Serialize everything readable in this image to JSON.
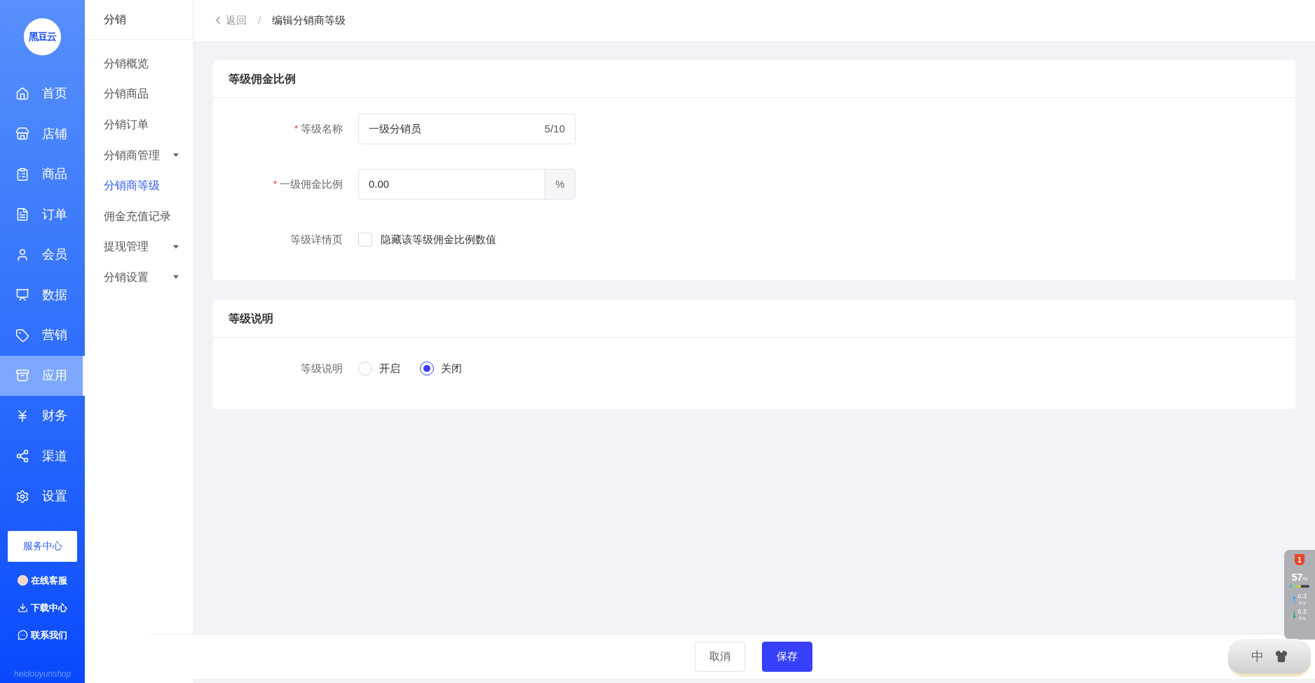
{
  "logo": {
    "text": "黑豆云"
  },
  "nav": [
    {
      "label": "首页",
      "selected": false
    },
    {
      "label": "店铺",
      "selected": false
    },
    {
      "label": "商品",
      "selected": false
    },
    {
      "label": "订单",
      "selected": false
    },
    {
      "label": "会员",
      "selected": false
    },
    {
      "label": "数据",
      "selected": false
    },
    {
      "label": "营销",
      "selected": false
    },
    {
      "label": "应用",
      "selected": true
    },
    {
      "label": "财务",
      "selected": false
    },
    {
      "label": "渠道",
      "selected": false
    },
    {
      "label": "设置",
      "selected": false
    }
  ],
  "service_button": "服务中心",
  "links": [
    {
      "label": "在线客服"
    },
    {
      "label": "下载中心"
    },
    {
      "label": "联系我们"
    }
  ],
  "brand": "heidouyunshop",
  "subnav": {
    "title": "分销",
    "items": [
      {
        "label": "分销概览",
        "selected": false,
        "expandable": false
      },
      {
        "label": "分销商品",
        "selected": false,
        "expandable": false
      },
      {
        "label": "分销订单",
        "selected": false,
        "expandable": false
      },
      {
        "label": "分销商管理",
        "selected": false,
        "expandable": true
      },
      {
        "label": "分销商等级",
        "selected": true,
        "expandable": false
      },
      {
        "label": "佣金充值记录",
        "selected": false,
        "expandable": false
      },
      {
        "label": "提现管理",
        "selected": false,
        "expandable": true
      },
      {
        "label": "分销设置",
        "selected": false,
        "expandable": true
      }
    ]
  },
  "breadcrumb": {
    "back": "返回",
    "separator": "/",
    "current": "编辑分销商等级"
  },
  "sections": [
    {
      "title": "等级佣金比例",
      "fields": [
        {
          "kind": "text",
          "label": "等级名称",
          "required_mark": "*",
          "value": "一级分销员",
          "counter": "5/10"
        },
        {
          "kind": "suffix",
          "label": "一级佣金比例",
          "required_mark": "*",
          "value": "0.00",
          "suffix": "%"
        },
        {
          "kind": "checkbox",
          "label": "等级详情页",
          "checked": false,
          "text": "隐藏该等级佣金比例数值"
        }
      ]
    },
    {
      "title": "等级说明",
      "fields": [
        {
          "kind": "radio",
          "label": "等级说明",
          "options": [
            {
              "label": "开启",
              "selected": false
            },
            {
              "label": "关闭",
              "selected": true
            }
          ]
        }
      ]
    }
  ],
  "footer_buttons": [
    {
      "label": "取消",
      "kind": "default"
    },
    {
      "label": "保存",
      "kind": "primary"
    }
  ],
  "system_monitor": {
    "badge": "1",
    "percent": "57",
    "unit": "%",
    "level": 0.57,
    "up": "0.3",
    "up_unit": "K/s",
    "down": "0.3",
    "down_unit": "K/s"
  },
  "ime": {
    "mode": "中"
  }
}
